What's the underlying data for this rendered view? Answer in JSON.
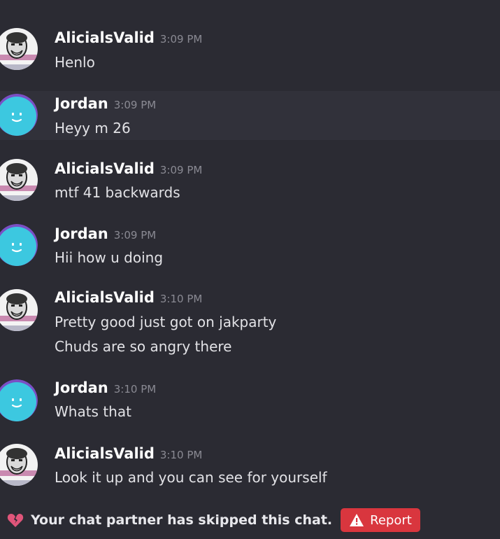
{
  "messages": [
    {
      "user": "AlicialsValid",
      "time": "3:09 PM",
      "lines": [
        "Henlo"
      ],
      "avatar": "troll-face-avatar"
    },
    {
      "user": "Jordan",
      "time": "3:09 PM",
      "lines": [
        "Heyy m 26"
      ],
      "avatar": "smiley-avatar"
    },
    {
      "user": "AlicialsValid",
      "time": "3:09 PM",
      "lines": [
        "mtf 41 backwards"
      ],
      "avatar": "troll-face-avatar"
    },
    {
      "user": "Jordan",
      "time": "3:09 PM",
      "lines": [
        "Hii how u doing"
      ],
      "avatar": "smiley-avatar"
    },
    {
      "user": "AlicialsValid",
      "time": "3:10 PM",
      "lines": [
        "Pretty good just got on jakparty",
        "Chuds are so angry there"
      ],
      "avatar": "troll-face-avatar"
    },
    {
      "user": "Jordan",
      "time": "3:10 PM",
      "lines": [
        "Whats that"
      ],
      "avatar": "smiley-avatar"
    },
    {
      "user": "AlicialsValid",
      "time": "3:10 PM",
      "lines": [
        "Look it up and you can see for yourself"
      ],
      "avatar": "troll-face-avatar"
    }
  ],
  "notice": {
    "icon": "broken-heart-icon",
    "text": "Your chat partner has skipped this chat.",
    "report_label": "Report",
    "report_icon": "warning-icon"
  },
  "colors": {
    "background": "#2b2b33",
    "highlight_row": "#31313a",
    "report_button": "#d9363e",
    "smiley_avatar": "#3cc8e0",
    "smiley_ring": "#7a4fc4"
  }
}
